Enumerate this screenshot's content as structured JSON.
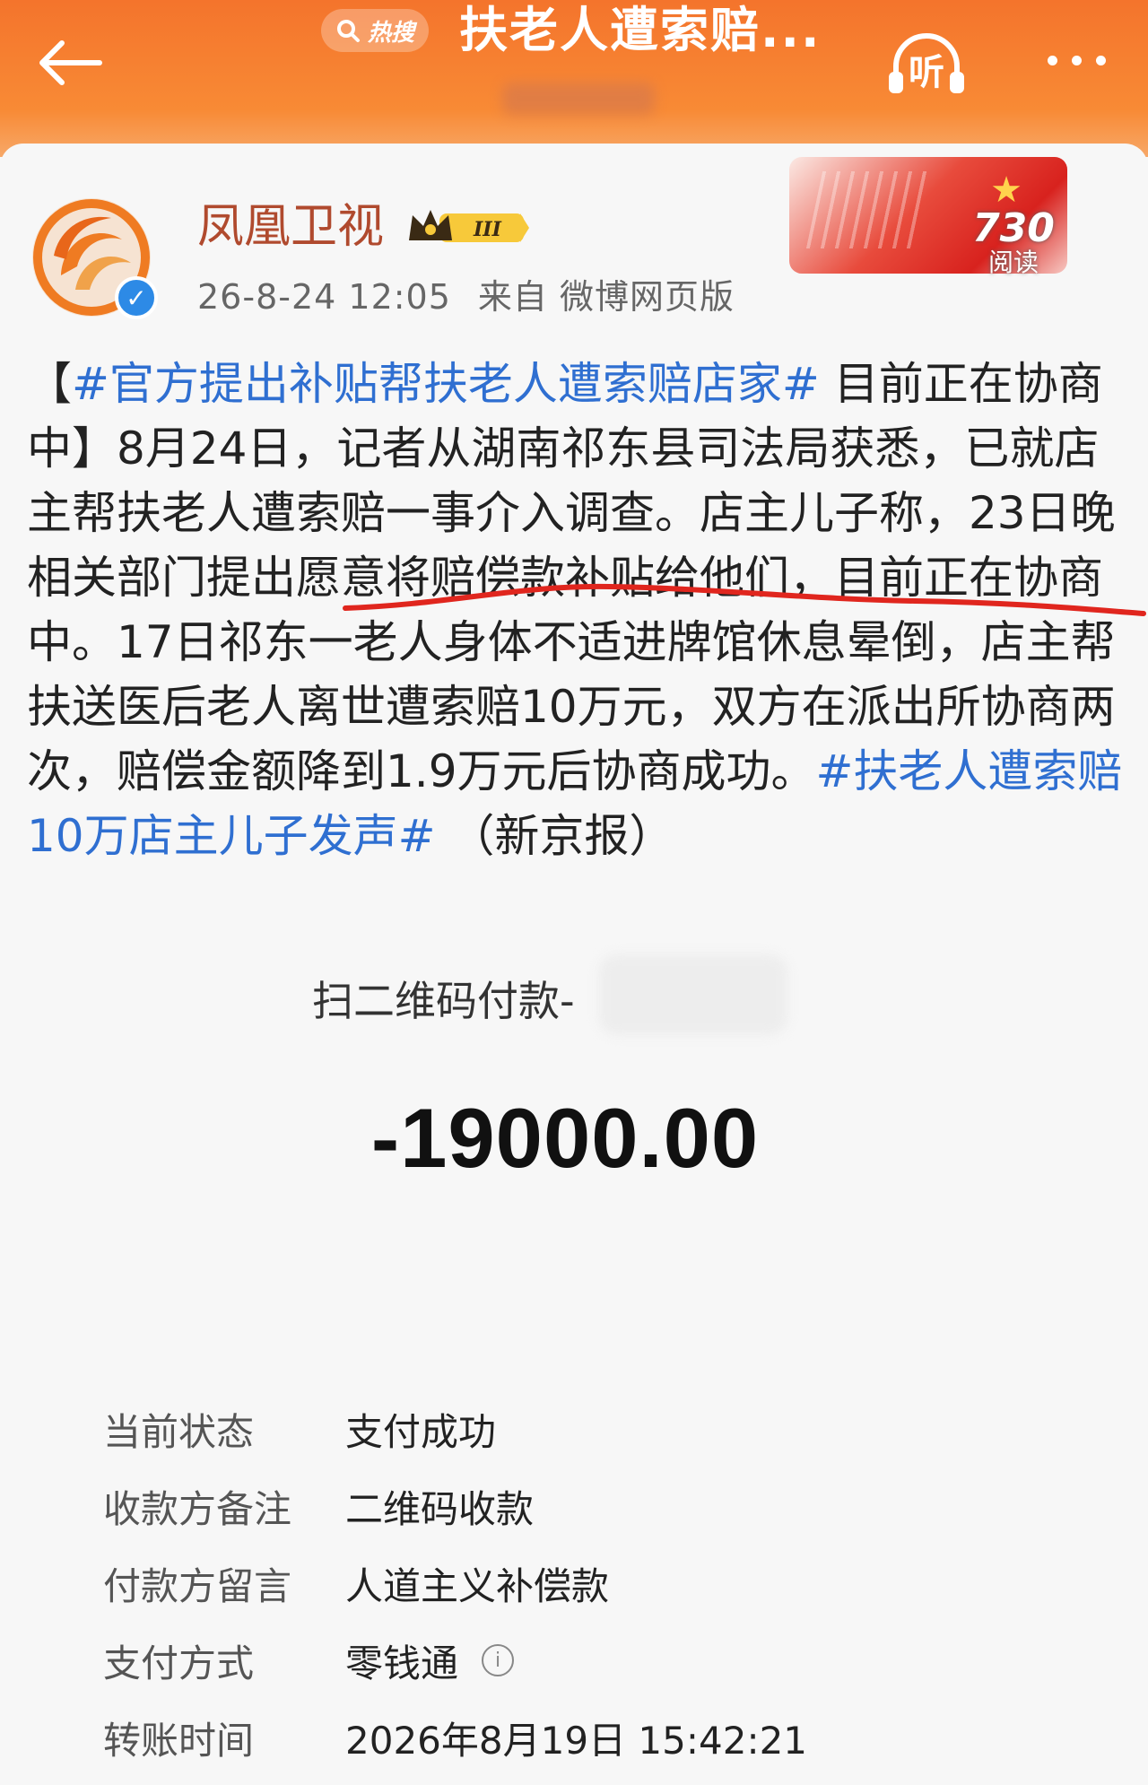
{
  "header": {
    "search_brand": "热搜",
    "title": "扶老人遭索赔...",
    "listen_label": "听"
  },
  "author": {
    "name": "凤凰卫视",
    "vip_level": "III",
    "date": "26-8-24 12:05",
    "source": "来自 微博网页版"
  },
  "banner": {
    "reads_count": "730",
    "reads_label": "阅读"
  },
  "post": {
    "lead_open": "【",
    "tag1": "#官方提出补贴帮扶老人遭索赔店家#",
    "lead_rest": " 目前正在协商中】8月24日，记者从湖南祁东县司法局获悉，已就店主帮扶老人遭索赔一事介入调查。店主儿子称，23日晚相关部门提出愿意将赔偿款补贴给他们，目前正在协商中。17日祁东一老人身体不适进牌馆休息晕倒，店主帮扶送医后老人离世遭索赔10万元，双方在派出所协商两次，赔偿金额降到1.9万元后协商成功。",
    "tag2": "#扶老人遭索赔10万店主儿子发声#",
    "tail": " （新京报）"
  },
  "payment": {
    "title": "扫二维码付款-",
    "amount": "-19000.00",
    "rows": [
      {
        "key": "当前状态",
        "value": "支付成功"
      },
      {
        "key": "收款方备注",
        "value": "二维码收款"
      },
      {
        "key": "付款方留言",
        "value": "人道主义补偿款"
      },
      {
        "key": "支付方式",
        "value": "零钱通"
      },
      {
        "key": "转账时间",
        "value": "2026年8月19日 15:42:21"
      }
    ]
  },
  "colors": {
    "header_orange": "#f4742c",
    "hashtag_blue": "#2f6fd1",
    "author_name": "#b04a2e",
    "underline_red": "#e0261e"
  }
}
